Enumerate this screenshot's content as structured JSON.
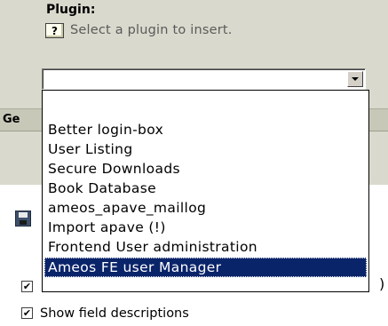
{
  "plugin_panel": {
    "label": "Plugin:",
    "help_glyph": "?",
    "hint": "Select a plugin to insert.",
    "selected_value": ""
  },
  "behind_panel": {
    "header_fragment": "Ge"
  },
  "dropdown": {
    "options": [
      "",
      "Better login-box",
      "User Listing",
      "Secure Downloads",
      "Book Database",
      "ameos_apave_maillog",
      "Import apave (!)",
      "Frontend User administration",
      "Ameos FE user Manager"
    ],
    "highlighted": "Ameos FE user Manager"
  },
  "checkboxes": {
    "first_label_fragment": ")",
    "show_field_descriptions": "Show field descriptions",
    "check_glyph": "✔"
  },
  "colors": {
    "panel_bg": "#d9d9cd",
    "highlight_bg": "#0a246a",
    "highlight_fg": "#ffffff"
  },
  "icons": {
    "help": "help-icon",
    "save": "save-icon",
    "dropdown_arrow": "chevron-down-icon"
  }
}
